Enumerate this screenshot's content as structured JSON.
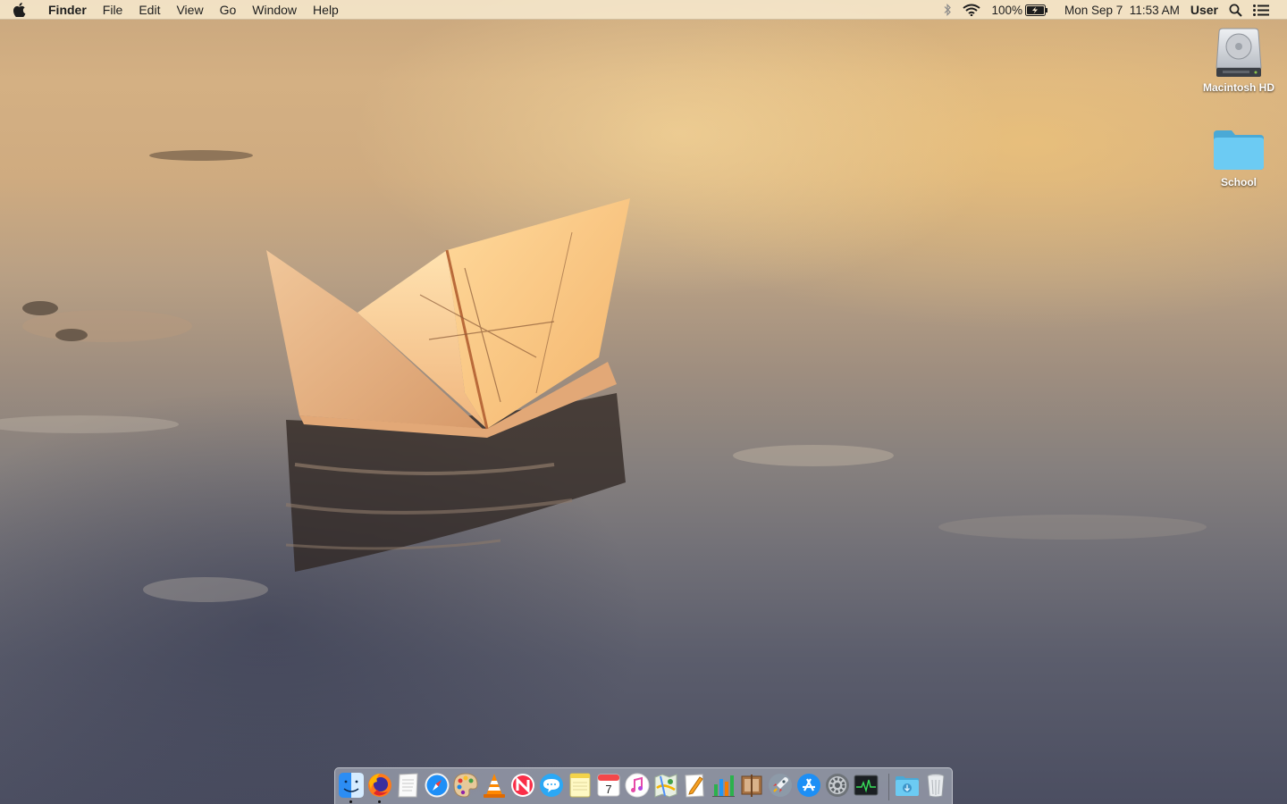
{
  "menubar": {
    "app_name": "Finder",
    "menus": [
      "File",
      "Edit",
      "View",
      "Go",
      "Window",
      "Help"
    ],
    "status": {
      "bluetooth_icon": "bluetooth-icon",
      "wifi_icon": "wifi-icon",
      "battery_percent": "100%",
      "battery_icon": "battery-charging-icon",
      "datetime": "Mon Sep 7  11:53 AM",
      "user": "User",
      "spotlight_icon": "search-icon",
      "notification_icon": "list-icon"
    }
  },
  "desktop": {
    "icons": [
      {
        "label": "Macintosh HD",
        "icon": "hard-drive-icon"
      },
      {
        "label": "School",
        "icon": "folder-icon"
      }
    ]
  },
  "dock": {
    "apps": [
      {
        "name": "Finder",
        "icon": "finder-icon",
        "running": true
      },
      {
        "name": "Firefox",
        "icon": "firefox-icon",
        "running": true
      },
      {
        "name": "TextEdit",
        "icon": "textedit-icon",
        "running": false
      },
      {
        "name": "Safari",
        "icon": "safari-icon",
        "running": false
      },
      {
        "name": "Paintbrush",
        "icon": "palette-icon",
        "running": false
      },
      {
        "name": "VLC",
        "icon": "vlc-cone-icon",
        "running": false
      },
      {
        "name": "News",
        "icon": "news-icon",
        "running": false
      },
      {
        "name": "Messages",
        "icon": "messages-icon",
        "running": false
      },
      {
        "name": "Notes",
        "icon": "notes-icon",
        "running": false
      },
      {
        "name": "Calendar",
        "icon": "calendar-icon",
        "running": false,
        "day": "7"
      },
      {
        "name": "iTunes",
        "icon": "music-note-icon",
        "running": false
      },
      {
        "name": "Maps",
        "icon": "maps-icon",
        "running": false
      },
      {
        "name": "Pages",
        "icon": "pages-icon",
        "running": false
      },
      {
        "name": "Numbers",
        "icon": "numbers-chart-icon",
        "running": false
      },
      {
        "name": "Keynote",
        "icon": "keynote-icon",
        "running": false
      },
      {
        "name": "Launchpad",
        "icon": "rocket-icon",
        "running": false
      },
      {
        "name": "App Store",
        "icon": "app-store-icon",
        "running": false
      },
      {
        "name": "System Preferences",
        "icon": "gear-icon",
        "running": false
      },
      {
        "name": "Activity Monitor",
        "icon": "activity-monitor-icon",
        "running": false
      }
    ],
    "stacks": [
      {
        "name": "Downloads",
        "icon": "downloads-folder-icon"
      },
      {
        "name": "Trash",
        "icon": "trash-icon"
      }
    ]
  }
}
